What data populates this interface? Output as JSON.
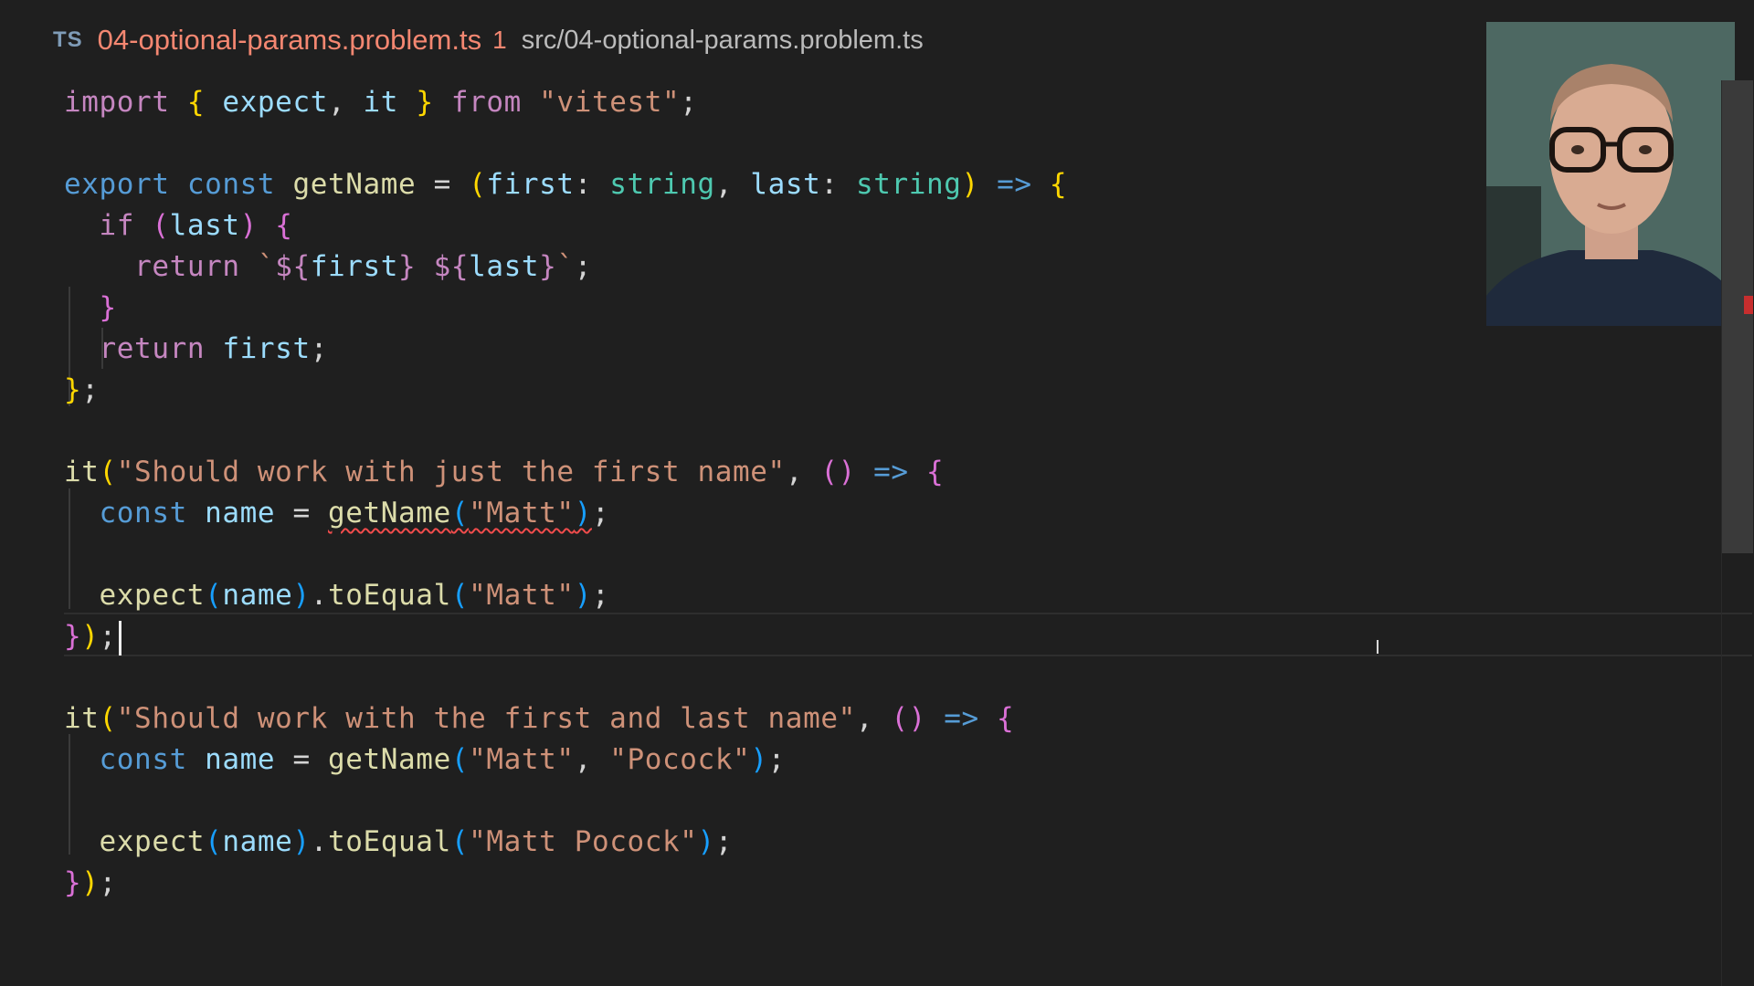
{
  "tab": {
    "icon_label": "TS",
    "filename": "04-optional-params.problem.ts",
    "problem_count": "1",
    "path": "src/04-optional-params.problem.ts"
  },
  "code": {
    "kw_import": "import",
    "kw_from": "from",
    "kw_export": "export",
    "kw_const": "const",
    "kw_if": "if",
    "kw_return": "return",
    "id_expect": "expect",
    "id_it": "it",
    "id_getName": "getName",
    "id_first": "first",
    "id_last": "last",
    "id_name": "name",
    "id_toEqual": "toEqual",
    "type_string": "string",
    "str_vitest": "\"vitest\"",
    "tpl_open": "`",
    "tpl_close": "`",
    "test1_title": "\"Should work with just the first name\"",
    "test2_title": "\"Should work with the first and last name\"",
    "str_matt": "\"Matt\"",
    "str_pocock": "\"Pocock\"",
    "str_matt_pocock": "\"Matt Pocock\""
  },
  "webcam": {
    "label": "presenter webcam"
  },
  "colors": {
    "background": "#1f1f1f",
    "tab_error": "#f48771",
    "keyword": "#c586c0",
    "storage": "#569cd6",
    "variable": "#9cdcfe",
    "function": "#dcdcaa",
    "string": "#ce9178",
    "type": "#4ec9b0",
    "error_squiggle": "#f14c4c"
  }
}
